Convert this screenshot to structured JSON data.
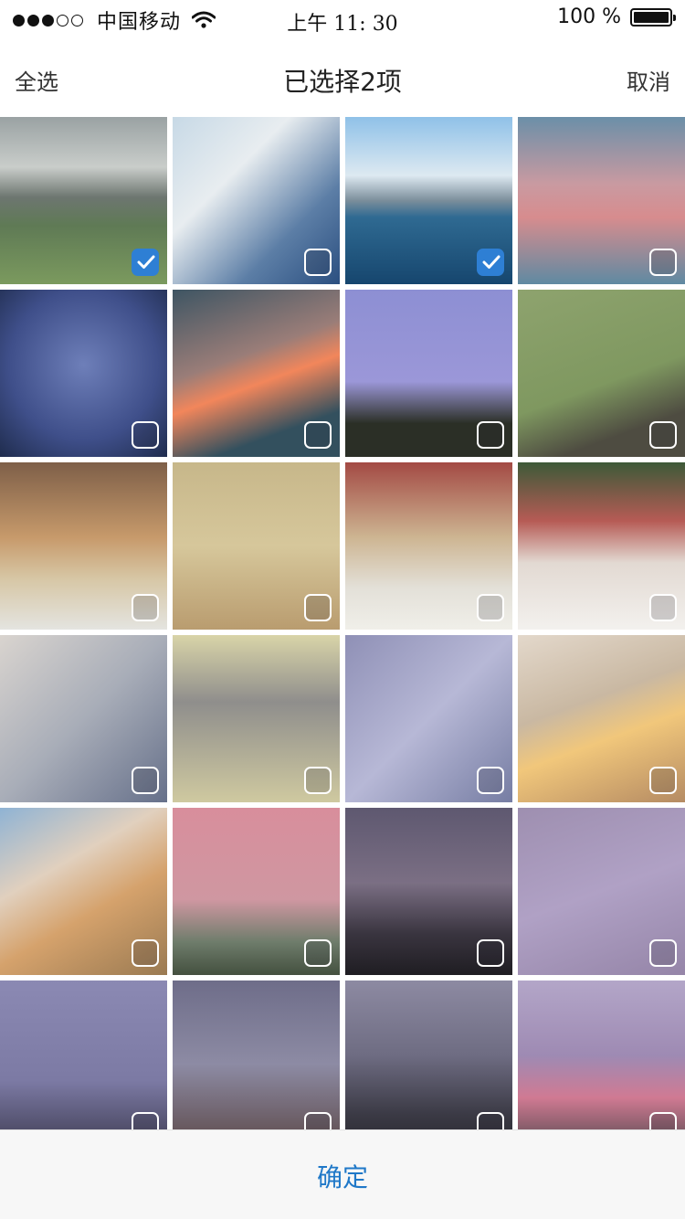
{
  "status_bar": {
    "signal_dots": [
      true,
      true,
      true,
      false,
      false
    ],
    "carrier": "中国移动",
    "time": "上午 11: 30",
    "battery": "100 %"
  },
  "nav": {
    "select_all": "全选",
    "title": "已选择2项",
    "cancel": "取消"
  },
  "photos": [
    {
      "name": "mountain-valley",
      "bg": "linear-gradient(180deg,#9aa2a3 0%,#c9cdca 30%,#6d7670 48%,#5f7a55 65%,#7b9a5e 100%)",
      "selected": true
    },
    {
      "name": "sky-clouds-rays",
      "bg": "linear-gradient(135deg,#c7d9e6 0%,#e8edf0 35%,#5c7ea6 70%,#2b4f80 100%)",
      "selected": false
    },
    {
      "name": "sea-horizon",
      "bg": "linear-gradient(180deg,#8fc1e8 0%,#dde9f1 35%,#7b8e9b 50%,#2f6a92 60%,#16466e 100%)",
      "selected": true
    },
    {
      "name": "pink-peaks",
      "bg": "linear-gradient(180deg,#6b8fa8 0%,#c99aa1 40%,#d78c8e 60%,#5f8aa2 100%)",
      "selected": false
    },
    {
      "name": "moon-tree-night",
      "bg": "radial-gradient(circle at 50% 45%,#6e7fb9 0%,#3f4f8a 60%,#1f2c4d 100%)",
      "selected": false
    },
    {
      "name": "pink-cloud-dusk",
      "bg": "linear-gradient(160deg,#3e5563 0%,#9a7d78 40%,#f2865b 55%,#33505e 80%)",
      "selected": false
    },
    {
      "name": "moon-hill-purple",
      "bg": "linear-gradient(180deg,#8d8fd3 0%,#9b97d8 55%,#2b2f26 80%)",
      "selected": false
    },
    {
      "name": "people-on-grass",
      "bg": "linear-gradient(160deg,#8ea36e 0%,#7f9860 55%,#4e4c41 80%)",
      "selected": false
    },
    {
      "name": "poster-wall-1",
      "bg": "linear-gradient(180deg,#7e5f48 0%,#c79a6b 45%,#d7c7a6 70%,#e4e4e0 100%)",
      "selected": false
    },
    {
      "name": "poster-wall-2",
      "bg": "linear-gradient(180deg,#c7b78a 0%,#d6c79b 50%,#b99c6f 100%)",
      "selected": false
    },
    {
      "name": "poster-wall-3",
      "bg": "linear-gradient(180deg,#a34a44 0%,#cdb592 45%,#e3e0d8 75%,#f0efe9 100%)",
      "selected": false
    },
    {
      "name": "poster-wall-4",
      "bg": "linear-gradient(180deg,#3d5a38 0%,#b65b55 35%,#e2d9d2 60%,#f3f1ee 100%)",
      "selected": false
    },
    {
      "name": "flower-shadow",
      "bg": "linear-gradient(135deg,#d9d4cf 0%,#a8adb8 50%,#66708a 100%)",
      "selected": false
    },
    {
      "name": "tulips-window",
      "bg": "linear-gradient(180deg,#d9d4a8 0%,#8f8e8c 40%,#cfc9a0 100%)",
      "selected": false
    },
    {
      "name": "rose-shadow",
      "bg": "linear-gradient(135deg,#8f90b6 0%,#b7b8d6 50%,#767da3 100%)",
      "selected": false
    },
    {
      "name": "cloud-poster-room",
      "bg": "linear-gradient(160deg,#e3d8cb 0%,#c9b8a2 40%,#f1c77b 60%,#b58b63 100%)",
      "selected": false
    },
    {
      "name": "skylight-room",
      "bg": "linear-gradient(150deg,#8fb3d4 0%,#e1d0be 35%,#d5a26c 60%,#9a7a52 100%)",
      "selected": false
    },
    {
      "name": "moon-birds-pink",
      "bg": "linear-gradient(180deg,#d88e9c 0%,#cf97a1 55%,#6f7d6c 80%,#44503f 100%)",
      "selected": false
    },
    {
      "name": "cloud-city-dusk",
      "bg": "linear-gradient(180deg,#5e5870 0%,#7b6f84 45%,#3a3540 75%,#1f1d22 100%)",
      "selected": false
    },
    {
      "name": "branch-moon",
      "bg": "linear-gradient(160deg,#9e8fb0 0%,#b0a1c5 50%,#9585a8 100%)",
      "selected": false
    },
    {
      "name": "sparkler",
      "bg": "linear-gradient(180deg,#8b89b3 0%,#7c7aa4 60%,#403e55 100%)",
      "selected": false
    },
    {
      "name": "building-dusk",
      "bg": "linear-gradient(180deg,#6e6d89 0%,#8d8ba4 50%,#5d4a4a 100%)",
      "selected": false
    },
    {
      "name": "city-lights",
      "bg": "linear-gradient(180deg,#8d8aa2 0%,#6e6c82 45%,#3b3a45 80%,#2a2930 100%)",
      "selected": false
    },
    {
      "name": "pink-flowers",
      "bg": "linear-gradient(180deg,#b3a6c8 0%,#9e8ab3 45%,#d07a93 70%,#5a4b51 100%)",
      "selected": false
    }
  ],
  "confirm": "确定"
}
